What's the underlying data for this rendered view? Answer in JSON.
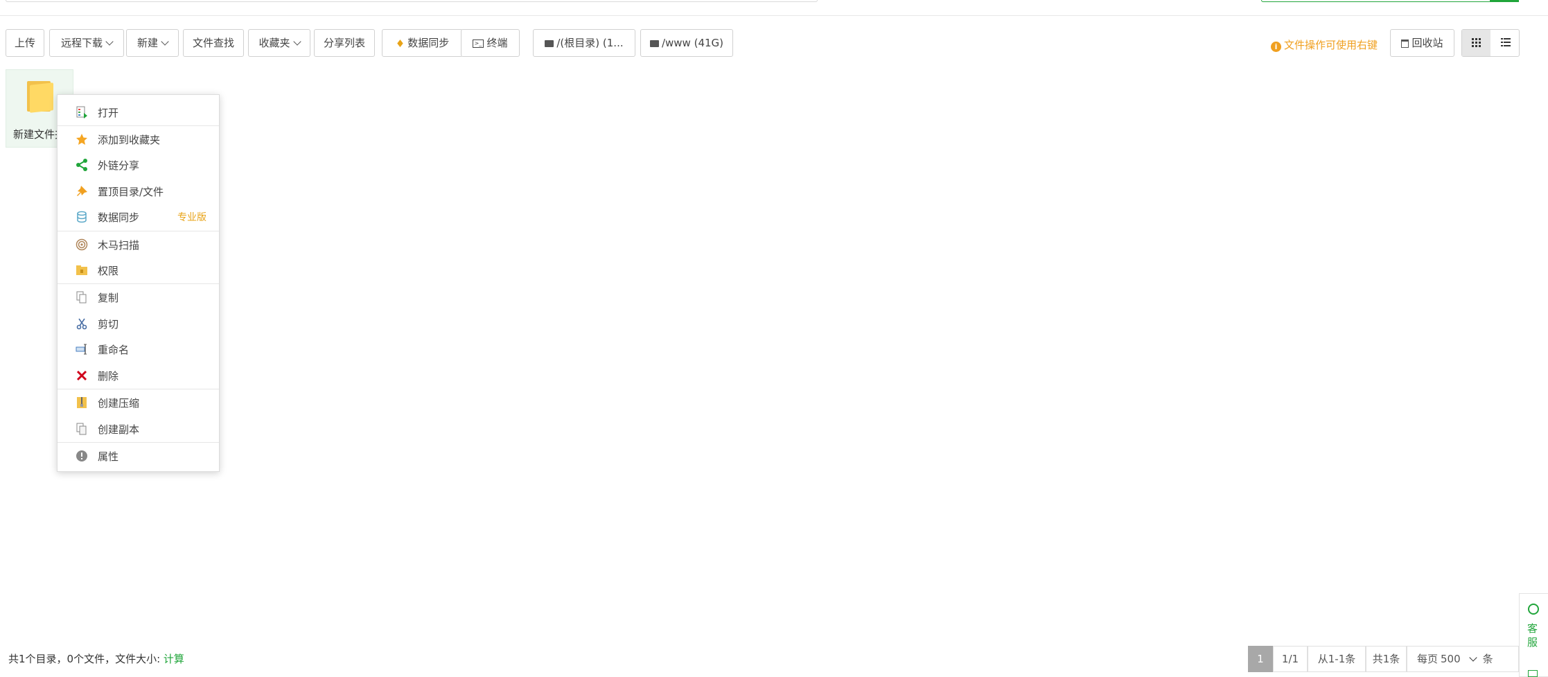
{
  "toolbar": {
    "upload": "上传",
    "remote_download": "远程下载",
    "new": "新建",
    "file_search": "文件查找",
    "favorites": "收藏夹",
    "share_list": "分享列表",
    "data_sync": "数据同步",
    "terminal": "终端",
    "disk_root": "/(根目录) (1...",
    "disk_www": "/www (41G)",
    "hint": "文件操作可使用右键",
    "recycle_bin": "回收站"
  },
  "file": {
    "name": "新建文件夹"
  },
  "context_menu": {
    "items": [
      {
        "label": "打开",
        "icon": "open-icon"
      },
      {
        "label": "添加到收藏夹",
        "icon": "star-icon"
      },
      {
        "label": "外链分享",
        "icon": "share-icon"
      },
      {
        "label": "置顶目录/文件",
        "icon": "pin-icon"
      },
      {
        "label": "数据同步",
        "icon": "database-icon",
        "badge": "专业版"
      },
      {
        "label": "木马扫描",
        "icon": "spiral-scan-icon"
      },
      {
        "label": "权限",
        "icon": "permission-folder-icon"
      },
      {
        "label": "复制",
        "icon": "copy-icon"
      },
      {
        "label": "剪切",
        "icon": "scissors-icon"
      },
      {
        "label": "重命名",
        "icon": "rename-icon"
      },
      {
        "label": "删除",
        "icon": "delete-x-icon"
      },
      {
        "label": "创建压缩",
        "icon": "zip-icon"
      },
      {
        "label": "创建副本",
        "icon": "duplicate-icon"
      },
      {
        "label": "属性",
        "icon": "info-icon"
      }
    ]
  },
  "status": {
    "summary": "共1个目录，0个文件，文件大小: ",
    "calc": "计算"
  },
  "pager": {
    "current": "1",
    "pages": "1/1",
    "range": "从1-1条",
    "total": "共1条",
    "per_page_label": "每页",
    "per_page_value": "500",
    "per_page_unit": "条"
  },
  "side_help": {
    "label": "客服"
  },
  "colors": {
    "accent": "#20a53a",
    "warning": "#f0a020",
    "pro": "#e8a317"
  }
}
